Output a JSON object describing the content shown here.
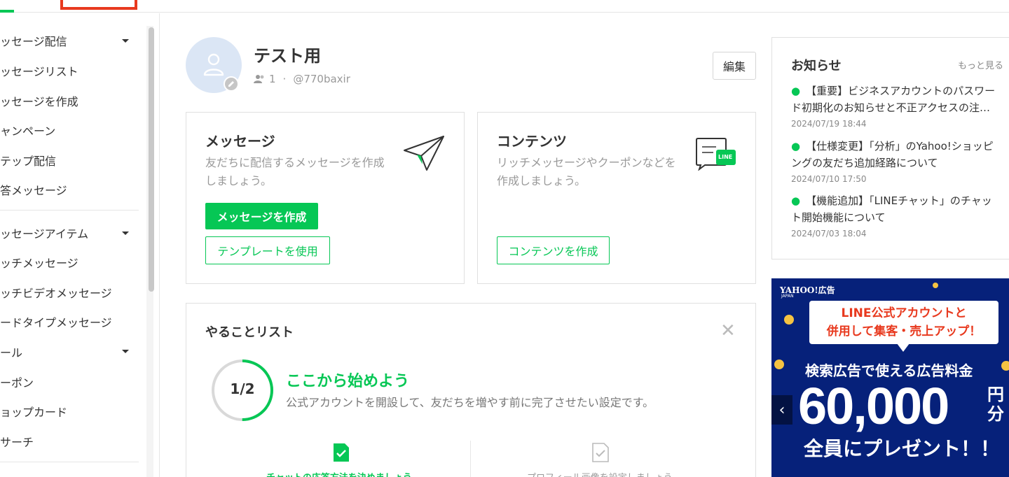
{
  "sidebar": {
    "groups": [
      {
        "label": "ッセージ配信",
        "items": [
          "ッセージリスト",
          "ッセージを作成",
          "ャンペーン",
          "テップ配信",
          "答メッセージ"
        ]
      },
      {
        "label": "ッセージアイテム",
        "items": [
          "ッチメッセージ",
          "ッチビデオメッセージ",
          "ードタイプメッセージ"
        ]
      },
      {
        "label": "ール",
        "items": [
          "ーポン",
          "ョップカード",
          "サーチ"
        ]
      }
    ]
  },
  "profile": {
    "name": "テスト用",
    "followers": "1",
    "separator": "·",
    "account_id": "@770baxir",
    "edit_label": "編集"
  },
  "message_card": {
    "title": "メッセージ",
    "desc_line1": "友だちに配信するメッセージを作成",
    "desc_line2": "しましょう。",
    "primary_label": "メッセージを作成",
    "secondary_label": "テンプレートを使用"
  },
  "content_card": {
    "title": "コンテンツ",
    "desc_line1": "リッチメッセージやクーポンなどを",
    "desc_line2": "作成しましょう。",
    "button_label": "コンテンツを作成",
    "badge_text": "LINE"
  },
  "todo": {
    "title": "やることリスト",
    "progress_label": "1/2",
    "progress_fraction": 0.5,
    "heading": "ここから始めよう",
    "subtitle": "公式アカウントを開設して、友だちを増やす前に完了させたい設定です。",
    "step1": "チャットの応答方法を決めましょう",
    "step2": "プロフィール画像を設定しましょう"
  },
  "news": {
    "title": "お知らせ",
    "more": "もっと見る",
    "items": [
      {
        "line1": "【重要】ビジネスアカウントのパスワー",
        "line2": "ド初期化のお知らせと不正アクセスの注…",
        "date": "2024/07/19 18:44"
      },
      {
        "line1": "【仕様変更】「分析」のYahoo!ショッピ",
        "line2": "ングの友だち追加経路について",
        "date": "2024/07/10 17:50"
      },
      {
        "line1": "【機能追加】「LINEチャット」のチャッ",
        "line2": "ト開始機能について",
        "date": "2024/07/03 18:04"
      }
    ]
  },
  "ad": {
    "logo": "YAHOO!広告",
    "logo_sub": "JAPAN",
    "bubble_line1": "LINE公式アカウントと",
    "bubble_line2": "併用して集客・売上アップ！",
    "line1": "検索広告で使える広告料金",
    "amount": "60,000",
    "unit_top": "円",
    "unit_bottom": "分",
    "line3": "全員にプレゼント！！",
    "prev": "‹"
  },
  "colors": {
    "brand_green": "#06c755",
    "highlight_red": "#e8391e",
    "ad_navy": "#06217a"
  }
}
